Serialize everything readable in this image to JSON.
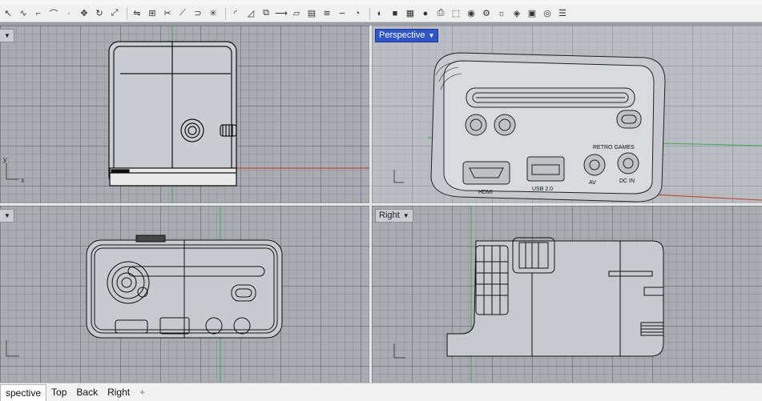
{
  "toolbar": {
    "icons": [
      "select-icon",
      "curve-icon",
      "polyline-icon",
      "arc-icon",
      "point-icon",
      "move-icon",
      "rotate-icon",
      "scale-icon",
      "mirror-icon",
      "array-icon",
      "trim-icon",
      "split-icon",
      "join-icon",
      "explode-icon",
      "fillet-icon",
      "chamfer-icon",
      "offset-icon",
      "extend-icon",
      "surface-icon",
      "extrude-icon",
      "loft-icon",
      "sweep-icon",
      "revolve-icon",
      "boolean-icon",
      "solid-icon",
      "mesh-icon",
      "sphere-icon",
      "print-icon",
      "box-icon",
      "render-icon",
      "settings-icon",
      "light-icon",
      "material-icon",
      "save-icon",
      "camera-icon",
      "layer-icon"
    ]
  },
  "viewports": {
    "top": {
      "title": ""
    },
    "perspective": {
      "title": "Perspective"
    },
    "back": {
      "title": ""
    },
    "right": {
      "title": "Right"
    }
  },
  "perspective_labels": {
    "hdmi": "HDMI",
    "usb": "USB 2.0",
    "av": "AV",
    "dcin": "DC IN",
    "brand": "RETRO GAMES"
  },
  "axes": {
    "x": "x",
    "y": "y"
  },
  "tabs": [
    "spective",
    "Top",
    "Back",
    "Right"
  ],
  "tab_add": "+",
  "colors": {
    "active_title": "#2f55c9",
    "grid": "#a8acb1",
    "x_axis": "#c0392b",
    "y_axis": "#27ae60"
  }
}
